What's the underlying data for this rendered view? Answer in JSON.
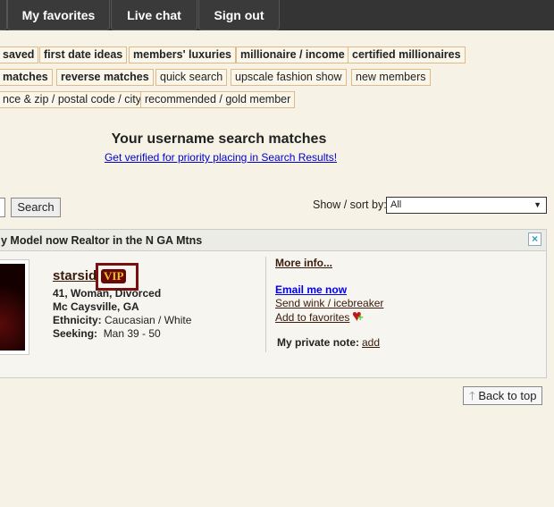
{
  "nav": {
    "tabs": [
      "My favorites",
      "Live chat",
      "Sign out"
    ]
  },
  "chips": {
    "row1": [
      "saved",
      "first date ideas",
      "members' luxuries",
      "millionaire / income",
      "certified millionaires"
    ],
    "row2": [
      "matches",
      "reverse matches",
      "quick search",
      "upscale fashion show",
      "new members"
    ],
    "row3": [
      "nce & zip / postal code / city",
      "recommended / gold member"
    ]
  },
  "heading": {
    "title": "Your username search matches",
    "verify_link": "Get verified for priority placing in Search Results!"
  },
  "search": {
    "button": "Search",
    "sort_label": "Show / sort by:",
    "sort_value": "All"
  },
  "profile": {
    "headline": "y Model now Realtor in the N GA Mtns",
    "username": "starsid",
    "badge": "VIP",
    "details": "41, Woman, Divorced",
    "location": "Mc Caysville, GA",
    "ethnicity_label": "Ethnicity:",
    "ethnicity": "Caucasian / White",
    "seeking_label": "Seeking:",
    "seeking": "Man 39 - 50",
    "more_info": "More info...",
    "email": "Email me now",
    "wink": "Send wink / icebreaker",
    "favorites": "Add to favorites",
    "note_label": "My private note:",
    "note_link": "add"
  },
  "back_to_top": "Back to top"
}
